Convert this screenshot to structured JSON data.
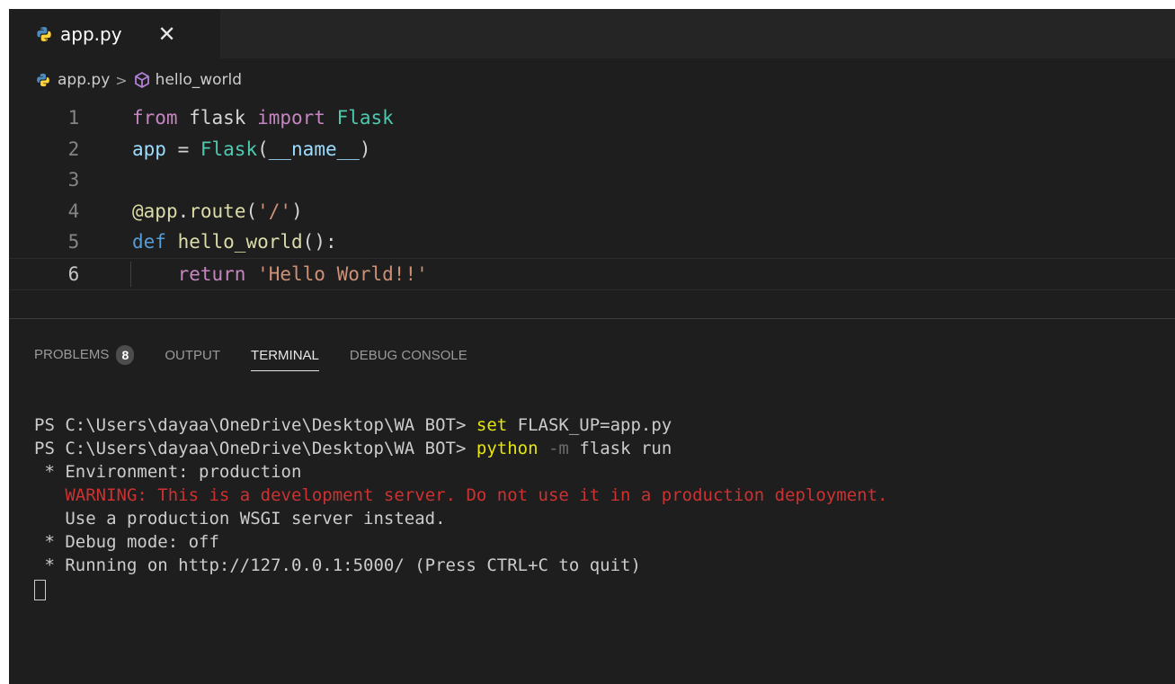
{
  "tab": {
    "label": "app.py",
    "close_glyph": "✕",
    "icon": "python-icon"
  },
  "breadcrumb": {
    "file": "app.py",
    "separator": ">",
    "symbol": "hello_world",
    "symbol_icon": "method-cube-icon"
  },
  "code": {
    "lines": [
      {
        "number": "1",
        "tokens": [
          {
            "t": "from",
            "c": "kw"
          },
          {
            "t": " flask ",
            "c": "txt"
          },
          {
            "t": "import",
            "c": "kw"
          },
          {
            "t": " ",
            "c": "txt"
          },
          {
            "t": "Flask",
            "c": "cls"
          }
        ]
      },
      {
        "number": "2",
        "tokens": [
          {
            "t": "app",
            "c": "var"
          },
          {
            "t": " = ",
            "c": "txt"
          },
          {
            "t": "Flask",
            "c": "cls"
          },
          {
            "t": "(",
            "c": "txt"
          },
          {
            "t": "__name__",
            "c": "var"
          },
          {
            "t": ")",
            "c": "txt"
          }
        ]
      },
      {
        "number": "3",
        "tokens": []
      },
      {
        "number": "4",
        "tokens": [
          {
            "t": "@",
            "c": "fn"
          },
          {
            "t": "app",
            "c": "fn"
          },
          {
            "t": ".",
            "c": "txt"
          },
          {
            "t": "route",
            "c": "fn"
          },
          {
            "t": "(",
            "c": "txt"
          },
          {
            "t": "'/'",
            "c": "str"
          },
          {
            "t": ")",
            "c": "txt"
          }
        ]
      },
      {
        "number": "5",
        "tokens": [
          {
            "t": "def",
            "c": "kwb"
          },
          {
            "t": " ",
            "c": "txt"
          },
          {
            "t": "hello_world",
            "c": "fn"
          },
          {
            "t": "():",
            "c": "txt"
          }
        ]
      },
      {
        "number": "6",
        "current": true,
        "tokens": [
          {
            "t": "    ",
            "c": "txt"
          },
          {
            "t": "return",
            "c": "kw"
          },
          {
            "t": " ",
            "c": "txt"
          },
          {
            "t": "'Hello World!!'",
            "c": "str"
          }
        ]
      }
    ]
  },
  "panel": {
    "tabs": [
      {
        "label": "PROBLEMS",
        "badge": "8",
        "active": false
      },
      {
        "label": "OUTPUT",
        "active": false
      },
      {
        "label": "TERMINAL",
        "active": true
      },
      {
        "label": "DEBUG CONSOLE",
        "active": false
      }
    ]
  },
  "terminal": {
    "lines": [
      [
        {
          "t": "PS C:\\Users\\dayaa\\OneDrive\\Desktop\\WA BOT> ",
          "c": ""
        },
        {
          "t": "set",
          "c": "t-yellow"
        },
        {
          "t": " FLASK_UP=app.py",
          "c": ""
        }
      ],
      [
        {
          "t": "PS C:\\Users\\dayaa\\OneDrive\\Desktop\\WA BOT> ",
          "c": ""
        },
        {
          "t": "python",
          "c": "t-yellow"
        },
        {
          "t": " ",
          "c": ""
        },
        {
          "t": "-m",
          "c": "t-dim"
        },
        {
          "t": " flask run",
          "c": ""
        }
      ],
      [
        {
          "t": " * Environment: production",
          "c": ""
        }
      ],
      [
        {
          "t": "   ",
          "c": ""
        },
        {
          "t": "WARNING: This is a development server. Do not use it in a production deployment.",
          "c": "t-red"
        }
      ],
      [
        {
          "t": "   Use a production WSGI server instead.",
          "c": ""
        }
      ],
      [
        {
          "t": " * Debug mode: off",
          "c": ""
        }
      ],
      [
        {
          "t": " * Running on http://127.0.0.1:5000/ (Press CTRL+C to quit)",
          "c": ""
        }
      ]
    ]
  },
  "colors": {
    "editor_bg": "#1e1e1e",
    "tabbar_bg": "#252526",
    "keyword": "#c586c0",
    "class": "#4ec9b0",
    "string": "#ce9178",
    "warning": "#cd3131"
  }
}
